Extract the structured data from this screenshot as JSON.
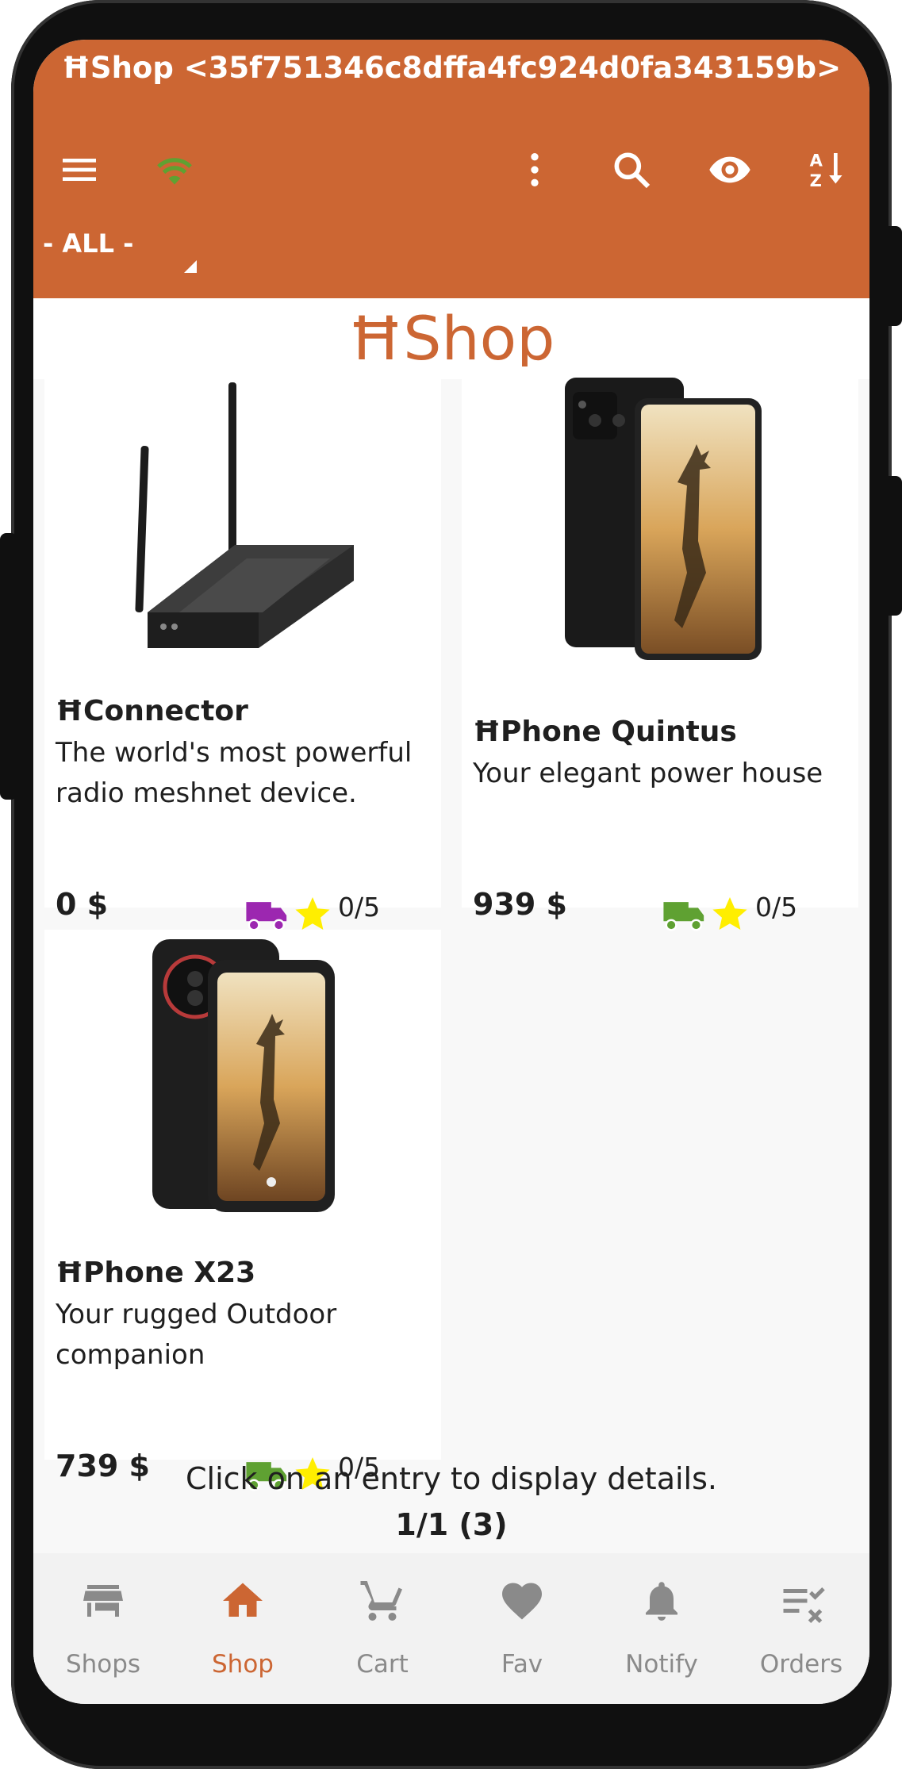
{
  "app": {
    "window_title": "ĦShop <35f751346c8dffa4fc924d0fa343159b>",
    "heading": "ĦShop",
    "accent_color": "#cc6633"
  },
  "toolbar": {
    "icons": [
      "menu-icon",
      "wifi-icon",
      "more-vert-icon",
      "search-icon",
      "visibility-icon",
      "sort-az-icon"
    ]
  },
  "filter": {
    "selected": "- ALL -"
  },
  "products": [
    {
      "name": "ĦConnector",
      "description": "The world's most powerful radio meshnet device.",
      "price": "0 $",
      "shipping_icon": "truck-icon",
      "shipping_color": "#9c27b0",
      "rating": "0/5"
    },
    {
      "name": "ĦPhone Quintus",
      "description": "Your elegant power house",
      "price": "939 $",
      "shipping_icon": "truck-icon",
      "shipping_color": "#5fa132",
      "rating": "0/5"
    },
    {
      "name": "ĦPhone X23",
      "description": "Your rugged Outdoor companion",
      "price": "739 $",
      "shipping_icon": "truck-icon",
      "shipping_color": "#5fa132",
      "rating": "0/5"
    }
  ],
  "footer": {
    "hint": "Click on an entry to display details.",
    "pager": "1/1 (3)"
  },
  "bottom_nav": {
    "items": [
      {
        "label": "Shops",
        "icon": "store-icon"
      },
      {
        "label": "Shop",
        "icon": "home-icon",
        "active": true
      },
      {
        "label": "Cart",
        "icon": "cart-icon"
      },
      {
        "label": "Fav",
        "icon": "heart-icon"
      },
      {
        "label": "Notify",
        "icon": "bell-icon"
      },
      {
        "label": "Orders",
        "icon": "orders-icon"
      }
    ]
  }
}
